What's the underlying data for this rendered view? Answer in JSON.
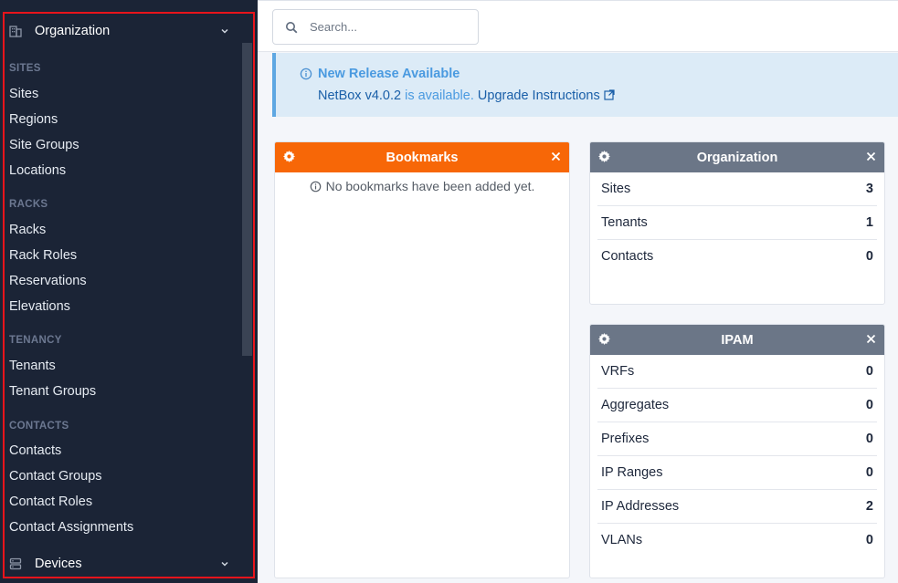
{
  "sidebar": {
    "organization_label": "Organization",
    "devices_label": "Devices",
    "sections": {
      "sites": "SITES",
      "racks": "RACKS",
      "tenancy": "TENANCY",
      "contacts": "CONTACTS"
    },
    "items": {
      "sites": "Sites",
      "regions": "Regions",
      "site_groups": "Site Groups",
      "locations": "Locations",
      "racks": "Racks",
      "rack_roles": "Rack Roles",
      "reservations": "Reservations",
      "elevations": "Elevations",
      "tenants": "Tenants",
      "tenant_groups": "Tenant Groups",
      "contacts": "Contacts",
      "contact_groups": "Contact Groups",
      "contact_roles": "Contact Roles",
      "contact_assignments": "Contact Assignments"
    }
  },
  "search": {
    "placeholder": "Search..."
  },
  "alert": {
    "title": "New Release Available",
    "version": "NetBox v4.0.2",
    "is_available": " is available. ",
    "link": "Upgrade Instructions"
  },
  "bookmarks": {
    "title": "Bookmarks",
    "empty": "No bookmarks have been added yet."
  },
  "organization_card": {
    "title": "Organization",
    "rows": [
      {
        "label": "Sites",
        "value": "3"
      },
      {
        "label": "Tenants",
        "value": "1"
      },
      {
        "label": "Contacts",
        "value": "0"
      }
    ]
  },
  "ipam_card": {
    "title": "IPAM",
    "rows": [
      {
        "label": "VRFs",
        "value": "0"
      },
      {
        "label": "Aggregates",
        "value": "0"
      },
      {
        "label": "Prefixes",
        "value": "0"
      },
      {
        "label": "IP Ranges",
        "value": "0"
      },
      {
        "label": "IP Addresses",
        "value": "2"
      },
      {
        "label": "VLANs",
        "value": "0"
      }
    ]
  },
  "colors": {
    "sidebar_bg": "#1b2436",
    "highlight_outline": "#e8141b",
    "bookmarks_header": "#f76707",
    "card_header": "#6b7687",
    "alert_bg": "#dcebf7"
  }
}
